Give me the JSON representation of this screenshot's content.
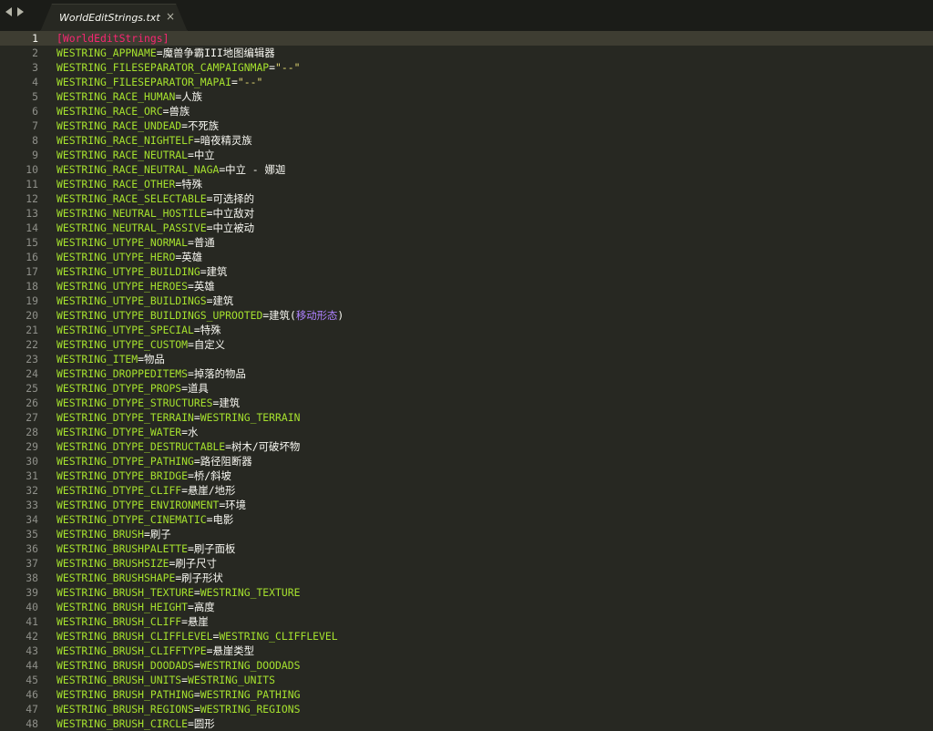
{
  "tab": {
    "title": "WorldEditStrings.txt",
    "close": "×"
  },
  "lines": [
    {
      "num": "1",
      "section": "[WorldEditStrings]"
    },
    {
      "num": "2",
      "key": "WESTRING_APPNAME",
      "value": "魔兽争霸III地图编辑器"
    },
    {
      "num": "3",
      "key": "WESTRING_FILESEPARATOR_CAMPAIGNMAP",
      "str": "\"--\""
    },
    {
      "num": "4",
      "key": "WESTRING_FILESEPARATOR_MAPAI",
      "str": "\"--\""
    },
    {
      "num": "5",
      "key": "WESTRING_RACE_HUMAN",
      "value": "人族"
    },
    {
      "num": "6",
      "key": "WESTRING_RACE_ORC",
      "value": "兽族"
    },
    {
      "num": "7",
      "key": "WESTRING_RACE_UNDEAD",
      "value": "不死族"
    },
    {
      "num": "8",
      "key": "WESTRING_RACE_NIGHTELF",
      "value": "暗夜精灵族"
    },
    {
      "num": "9",
      "key": "WESTRING_RACE_NEUTRAL",
      "value": "中立"
    },
    {
      "num": "10",
      "key": "WESTRING_RACE_NEUTRAL_NAGA",
      "value": "中立 - 娜迦"
    },
    {
      "num": "11",
      "key": "WESTRING_RACE_OTHER",
      "value": "特殊"
    },
    {
      "num": "12",
      "key": "WESTRING_RACE_SELECTABLE",
      "value": "可选择的"
    },
    {
      "num": "13",
      "key": "WESTRING_NEUTRAL_HOSTILE",
      "value": "中立敌对"
    },
    {
      "num": "14",
      "key": "WESTRING_NEUTRAL_PASSIVE",
      "value": "中立被动"
    },
    {
      "num": "15",
      "key": "WESTRING_UTYPE_NORMAL",
      "value": "普通"
    },
    {
      "num": "16",
      "key": "WESTRING_UTYPE_HERO",
      "value": "英雄"
    },
    {
      "num": "17",
      "key": "WESTRING_UTYPE_BUILDING",
      "value": "建筑"
    },
    {
      "num": "18",
      "key": "WESTRING_UTYPE_HEROES",
      "value": "英雄"
    },
    {
      "num": "19",
      "key": "WESTRING_UTYPE_BUILDINGS",
      "value": "建筑"
    },
    {
      "num": "20",
      "key": "WESTRING_UTYPE_BUILDINGS_UPROOTED",
      "value": "建筑(",
      "paren": "移动形态",
      "tail": ")"
    },
    {
      "num": "21",
      "key": "WESTRING_UTYPE_SPECIAL",
      "value": "特殊"
    },
    {
      "num": "22",
      "key": "WESTRING_UTYPE_CUSTOM",
      "value": "自定义"
    },
    {
      "num": "23",
      "key": "WESTRING_ITEM",
      "value": "物品"
    },
    {
      "num": "24",
      "key": "WESTRING_DROPPEDITEMS",
      "value": "掉落的物品"
    },
    {
      "num": "25",
      "key": "WESTRING_DTYPE_PROPS",
      "value": "道具"
    },
    {
      "num": "26",
      "key": "WESTRING_DTYPE_STRUCTURES",
      "value": "建筑"
    },
    {
      "num": "27",
      "key": "WESTRING_DTYPE_TERRAIN",
      "ref": "WESTRING_TERRAIN"
    },
    {
      "num": "28",
      "key": "WESTRING_DTYPE_WATER",
      "value": "水"
    },
    {
      "num": "29",
      "key": "WESTRING_DTYPE_DESTRUCTABLE",
      "value": "树木/可破坏物"
    },
    {
      "num": "30",
      "key": "WESTRING_DTYPE_PATHING",
      "value": "路径阻断器"
    },
    {
      "num": "31",
      "key": "WESTRING_DTYPE_BRIDGE",
      "value": "桥/斜坡"
    },
    {
      "num": "32",
      "key": "WESTRING_DTYPE_CLIFF",
      "value": "悬崖/地形"
    },
    {
      "num": "33",
      "key": "WESTRING_DTYPE_ENVIRONMENT",
      "value": "环境"
    },
    {
      "num": "34",
      "key": "WESTRING_DTYPE_CINEMATIC",
      "value": "电影"
    },
    {
      "num": "35",
      "key": "WESTRING_BRUSH",
      "value": "刷子"
    },
    {
      "num": "36",
      "key": "WESTRING_BRUSHPALETTE",
      "value": "刷子面板"
    },
    {
      "num": "37",
      "key": "WESTRING_BRUSHSIZE",
      "value": "刷子尺寸"
    },
    {
      "num": "38",
      "key": "WESTRING_BRUSHSHAPE",
      "value": "刷子形状"
    },
    {
      "num": "39",
      "key": "WESTRING_BRUSH_TEXTURE",
      "ref": "WESTRING_TEXTURE"
    },
    {
      "num": "40",
      "key": "WESTRING_BRUSH_HEIGHT",
      "value": "高度"
    },
    {
      "num": "41",
      "key": "WESTRING_BRUSH_CLIFF",
      "value": "悬崖"
    },
    {
      "num": "42",
      "key": "WESTRING_BRUSH_CLIFFLEVEL",
      "ref": "WESTRING_CLIFFLEVEL"
    },
    {
      "num": "43",
      "key": "WESTRING_BRUSH_CLIFFTYPE",
      "value": "悬崖类型"
    },
    {
      "num": "44",
      "key": "WESTRING_BRUSH_DOODADS",
      "ref": "WESTRING_DOODADS"
    },
    {
      "num": "45",
      "key": "WESTRING_BRUSH_UNITS",
      "ref": "WESTRING_UNITS"
    },
    {
      "num": "46",
      "key": "WESTRING_BRUSH_PATHING",
      "ref": "WESTRING_PATHING"
    },
    {
      "num": "47",
      "key": "WESTRING_BRUSH_REGIONS",
      "ref": "WESTRING_REGIONS"
    },
    {
      "num": "48",
      "key": "WESTRING_BRUSH_CIRCLE",
      "value": "圆形"
    }
  ]
}
